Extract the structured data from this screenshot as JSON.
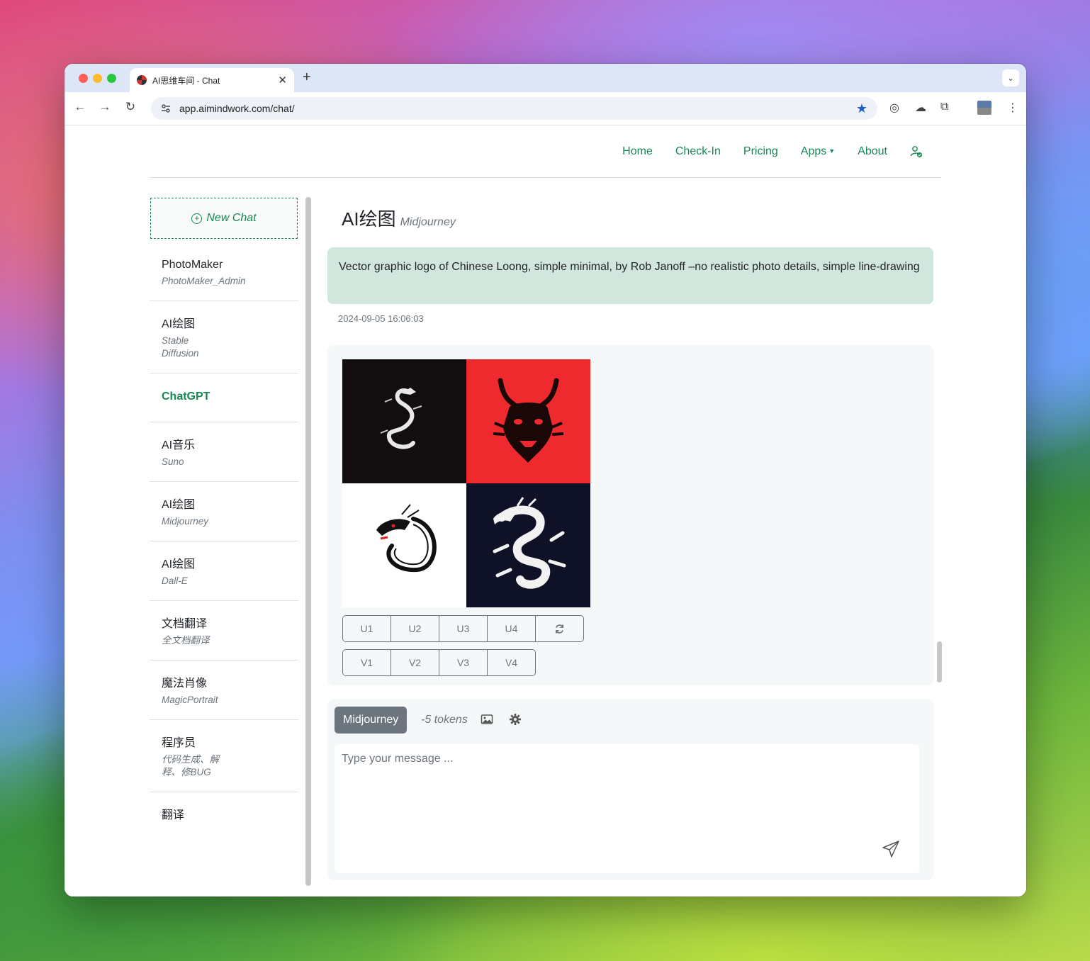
{
  "browser": {
    "tab_title": "AI思维车间 - Chat",
    "url": "app.aimindwork.com/chat/"
  },
  "nav": {
    "links": [
      "Home",
      "Check-In",
      "Pricing",
      "Apps",
      "About"
    ]
  },
  "sidebar": {
    "new_chat": "New Chat",
    "items": [
      {
        "name": "PhotoMaker",
        "sub": "PhotoMaker_Admin"
      },
      {
        "name": "AI绘图",
        "sub": "Stable\nDiffusion"
      },
      {
        "name": "ChatGPT",
        "sub": ""
      },
      {
        "name": "AI音乐",
        "sub": "Suno"
      },
      {
        "name": "AI绘图",
        "sub": "Midjourney"
      },
      {
        "name": "AI绘图",
        "sub": "Dall-E"
      },
      {
        "name": "文档翻译",
        "sub": "全文档翻译"
      },
      {
        "name": "魔法肖像",
        "sub": "MagicPortrait"
      },
      {
        "name": "程序员",
        "sub": "代码生成、解\n释、修BUG"
      },
      {
        "name": "翻译",
        "sub": ""
      }
    ]
  },
  "chat": {
    "title": "AI绘图",
    "subtitle": "Midjourney",
    "user_message": "Vector graphic logo of Chinese Loong, simple minimal, by Rob Janoff –no realistic photo details, simple line-drawing",
    "timestamp": "2024-09-05 16:06:03",
    "upscale_buttons": [
      "U1",
      "U2",
      "U3",
      "U4"
    ],
    "variation_buttons": [
      "V1",
      "V2",
      "V3",
      "V4"
    ]
  },
  "composer": {
    "model": "Midjourney",
    "tokens": "-5 tokens",
    "placeholder": "Type your message ..."
  },
  "colors": {
    "accent": "#198754",
    "user_bubble": "#d1e7dd"
  }
}
